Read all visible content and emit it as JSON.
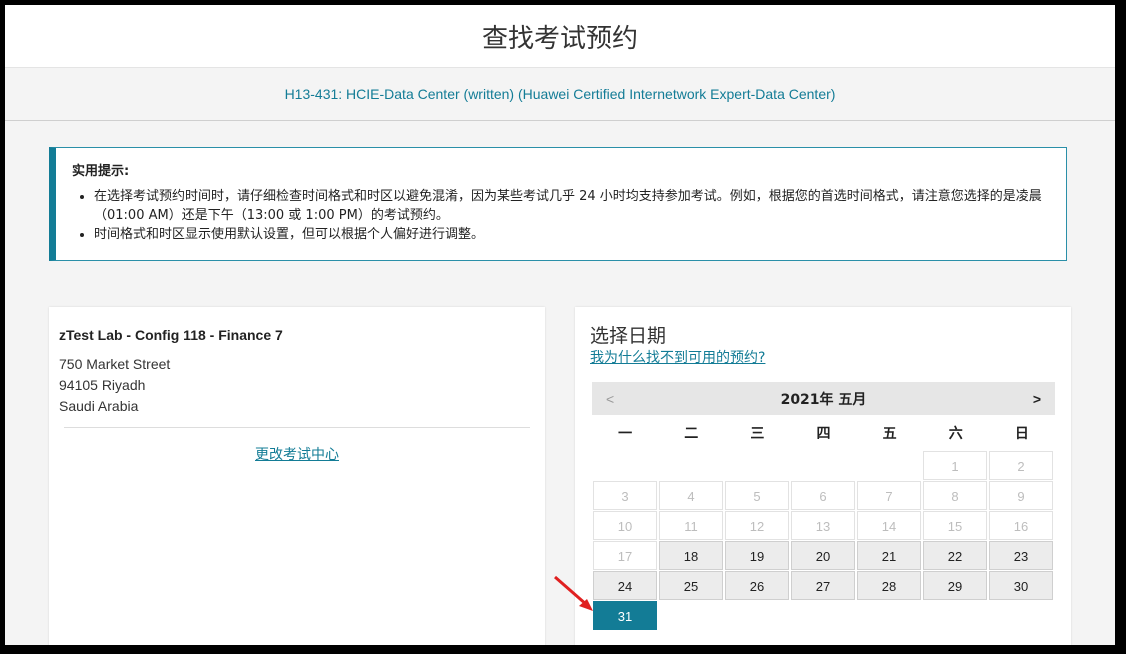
{
  "page_title": "查找考试预约",
  "exam": {
    "name": "H13-431: HCIE-Data Center (written) (Huawei Certified Internetwork Expert-Data Center)"
  },
  "tip": {
    "title": "实用提示:",
    "items": [
      "在选择考试预约时间时，请仔细检查时间格式和时区以避免混淆，因为某些考试几乎 24 小时均支持参加考试。例如，根据您的首选时间格式，请注意您选择的是凌晨（01:00 AM）还是下午（13:00 或 1:00 PM）的考试预约。",
      "时间格式和时区显示使用默认设置，但可以根据个人偏好进行调整。"
    ]
  },
  "location": {
    "name": "zTest Lab - Config 118 - Finance 7",
    "address_line1": "750 Market Street",
    "address_line2": "94105 Riyadh",
    "address_line3": "Saudi Arabia",
    "change_link": "更改考试中心"
  },
  "date_picker": {
    "title": "选择日期",
    "why_link": "我为什么找不到可用的预约?",
    "calendar": {
      "prev": "<",
      "month_title": "2021年 五月",
      "next": ">",
      "weekdays": [
        "一",
        "二",
        "三",
        "四",
        "五",
        "六",
        "日"
      ],
      "leading_blanks": 5,
      "days_in_month": 31,
      "disabled_days": [
        1,
        2,
        3,
        4,
        5,
        6,
        7,
        8,
        9,
        10,
        11,
        12,
        13,
        14,
        15,
        16,
        17
      ],
      "selected_day": 31
    }
  },
  "colors": {
    "accent": "#137c96",
    "annotation_arrow": "#e02020"
  }
}
